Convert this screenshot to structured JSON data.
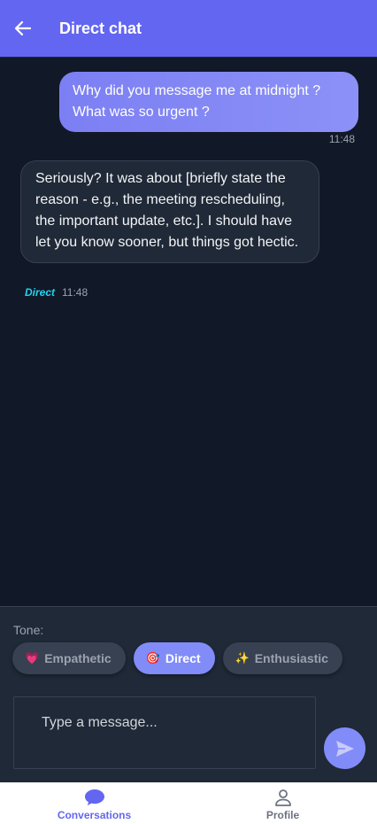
{
  "header": {
    "title": "Direct chat",
    "back_icon": "arrow-left-icon"
  },
  "messages": [
    {
      "sender": "user",
      "text": "Why did you message me at midnight ? What was so urgent ?",
      "time": "11:48"
    },
    {
      "sender": "assistant",
      "text": "Seriously? It was about [briefly state the reason - e.g., the meeting rescheduling, the important update, etc.]. I should have let you know sooner, but things got hectic.",
      "tone": "Direct",
      "time": "11:48"
    }
  ],
  "composer": {
    "tone_label": "Tone:",
    "tones": [
      {
        "emoji": "💗",
        "label": "Empathetic",
        "active": false
      },
      {
        "emoji": "🎯",
        "label": "Direct",
        "active": true
      },
      {
        "emoji": "✨",
        "label": "Enthusiastic",
        "active": false
      }
    ],
    "placeholder": "Type a message...",
    "send_icon": "send-icon"
  },
  "nav": {
    "items": [
      {
        "label": "Conversations",
        "icon": "chat-bubble-icon",
        "active": true
      },
      {
        "label": "Profile",
        "icon": "person-icon",
        "active": false
      }
    ]
  },
  "colors": {
    "accent": "#6366f1",
    "accent_light": "#818cf8",
    "background": "#111827",
    "surface": "#1f2937",
    "tone_tag": "#22d3ee"
  }
}
